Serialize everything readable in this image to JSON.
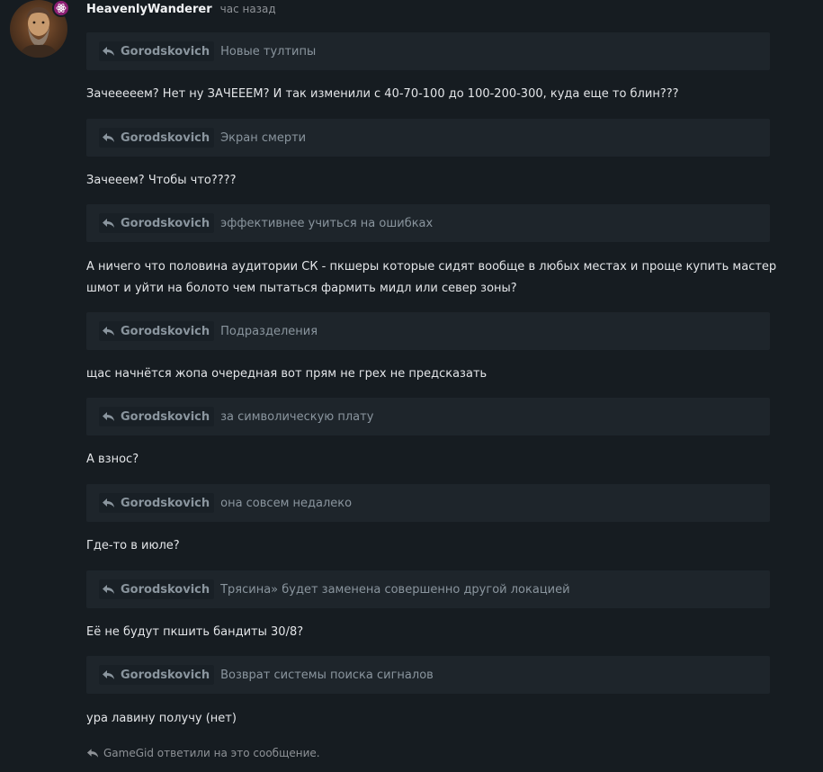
{
  "post": {
    "author": "HeavenlyWanderer",
    "time": "час назад",
    "blocks": [
      {
        "quote_author": "Gorodskovich",
        "quote_text": "Новые тултипы",
        "reply": "Зачееееем? Нет ну ЗАЧЕЕЕМ? И так изменили с 40-70-100 до 100-200-300, куда еще то блин???"
      },
      {
        "quote_author": "Gorodskovich",
        "quote_text": "Экран смерти",
        "reply": "Зачееем? Чтобы что????"
      },
      {
        "quote_author": "Gorodskovich",
        "quote_text": "эффективнее учиться на ошибках",
        "reply": "А ничего что половина аудитории СК - пкшеры которые сидят вообще в любых местах и проще купить мастер шмот и уйти на болото чем пытаться фармить мидл или север зоны?"
      },
      {
        "quote_author": "Gorodskovich",
        "quote_text": "Подразделения",
        "reply": "щас начнётся жопа очередная вот прям не грех не предсказать"
      },
      {
        "quote_author": "Gorodskovich",
        "quote_text": "за символическую плату",
        "reply": "А взнос?"
      },
      {
        "quote_author": "Gorodskovich",
        "quote_text": "она совсем недалеко",
        "reply": "Где-то в июле?"
      },
      {
        "quote_author": "Gorodskovich",
        "quote_text": "Трясина» будет заменена совершенно другой локацией",
        "reply": "Её не будут пкшить бандиты 30/8?"
      },
      {
        "quote_author": "Gorodskovich",
        "quote_text": "Возврат системы поиска сигналов",
        "reply": "ура лавину получу (нет)"
      }
    ],
    "footer": "GameGid ответили на это сообщение."
  },
  "colors": {
    "background": "#161c21",
    "quote_bg": "#1e252b",
    "badge": "#8d1f74",
    "muted": "#8a959e"
  },
  "icons": {
    "reply": "reply-arrow-icon",
    "badge": "react-atom-icon"
  }
}
